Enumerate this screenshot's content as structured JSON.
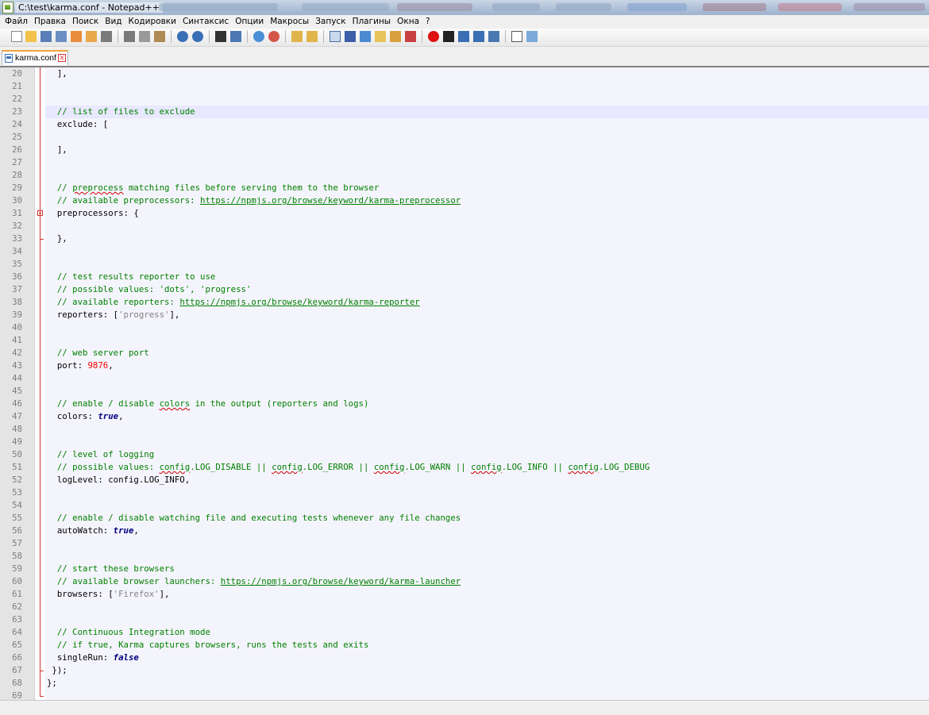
{
  "window": {
    "title": "C:\\test\\karma.conf - Notepad++"
  },
  "menu": [
    "Файл",
    "Правка",
    "Поиск",
    "Вид",
    "Кодировки",
    "Синтаксис",
    "Опции",
    "Макросы",
    "Запуск",
    "Плагины",
    "Окна",
    "?"
  ],
  "tab": {
    "label": "karma.conf",
    "close": "x"
  },
  "colors": {
    "comment": "#008000",
    "number": "#ff0000",
    "string": "#808080",
    "keyword": "#000080",
    "current_line": "#e8e8ff",
    "fold_marker": "#d03030"
  },
  "editor": {
    "current_line": 23,
    "lines": [
      {
        "n": "20",
        "t": "  ],"
      },
      {
        "n": "21",
        "t": ""
      },
      {
        "n": "22",
        "t": ""
      },
      {
        "n": "23",
        "t": "  // list of files to exclude"
      },
      {
        "n": "24",
        "t": "  exclude: ["
      },
      {
        "n": "25",
        "t": ""
      },
      {
        "n": "26",
        "t": "  ],"
      },
      {
        "n": "27",
        "t": ""
      },
      {
        "n": "28",
        "t": ""
      },
      {
        "n": "29",
        "t": "  // preprocess matching files before serving them to the browser"
      },
      {
        "n": "30",
        "t": "  // available preprocessors: https://npmjs.org/browse/keyword/karma-preprocessor"
      },
      {
        "n": "31",
        "t": "  preprocessors: {"
      },
      {
        "n": "32",
        "t": ""
      },
      {
        "n": "33",
        "t": "  },"
      },
      {
        "n": "34",
        "t": ""
      },
      {
        "n": "35",
        "t": ""
      },
      {
        "n": "36",
        "t": "  // test results reporter to use"
      },
      {
        "n": "37",
        "t": "  // possible values: 'dots', 'progress'"
      },
      {
        "n": "38",
        "t": "  // available reporters: https://npmjs.org/browse/keyword/karma-reporter"
      },
      {
        "n": "39",
        "t": "  reporters: ['progress'],"
      },
      {
        "n": "40",
        "t": ""
      },
      {
        "n": "41",
        "t": ""
      },
      {
        "n": "42",
        "t": "  // web server port"
      },
      {
        "n": "43",
        "t": "  port: 9876,"
      },
      {
        "n": "44",
        "t": ""
      },
      {
        "n": "45",
        "t": ""
      },
      {
        "n": "46",
        "t": "  // enable / disable colors in the output (reporters and logs)"
      },
      {
        "n": "47",
        "t": "  colors: true,"
      },
      {
        "n": "48",
        "t": ""
      },
      {
        "n": "49",
        "t": ""
      },
      {
        "n": "50",
        "t": "  // level of logging"
      },
      {
        "n": "51",
        "t": "  // possible values: config.LOG_DISABLE || config.LOG_ERROR || config.LOG_WARN || config.LOG_INFO || config.LOG_DEBUG"
      },
      {
        "n": "52",
        "t": "  logLevel: config.LOG_INFO,"
      },
      {
        "n": "53",
        "t": ""
      },
      {
        "n": "54",
        "t": ""
      },
      {
        "n": "55",
        "t": "  // enable / disable watching file and executing tests whenever any file changes"
      },
      {
        "n": "56",
        "t": "  autoWatch: true,"
      },
      {
        "n": "57",
        "t": ""
      },
      {
        "n": "58",
        "t": ""
      },
      {
        "n": "59",
        "t": "  // start these browsers"
      },
      {
        "n": "60",
        "t": "  // available browser launchers: https://npmjs.org/browse/keyword/karma-launcher"
      },
      {
        "n": "61",
        "t": "  browsers: ['Firefox'],"
      },
      {
        "n": "62",
        "t": ""
      },
      {
        "n": "63",
        "t": ""
      },
      {
        "n": "64",
        "t": "  // Continuous Integration mode"
      },
      {
        "n": "65",
        "t": "  // if true, Karma captures browsers, runs the tests and exits"
      },
      {
        "n": "66",
        "t": "  singleRun: false"
      },
      {
        "n": "67",
        "t": " });"
      },
      {
        "n": "68",
        "t": "};"
      },
      {
        "n": "69",
        "t": ""
      }
    ]
  }
}
